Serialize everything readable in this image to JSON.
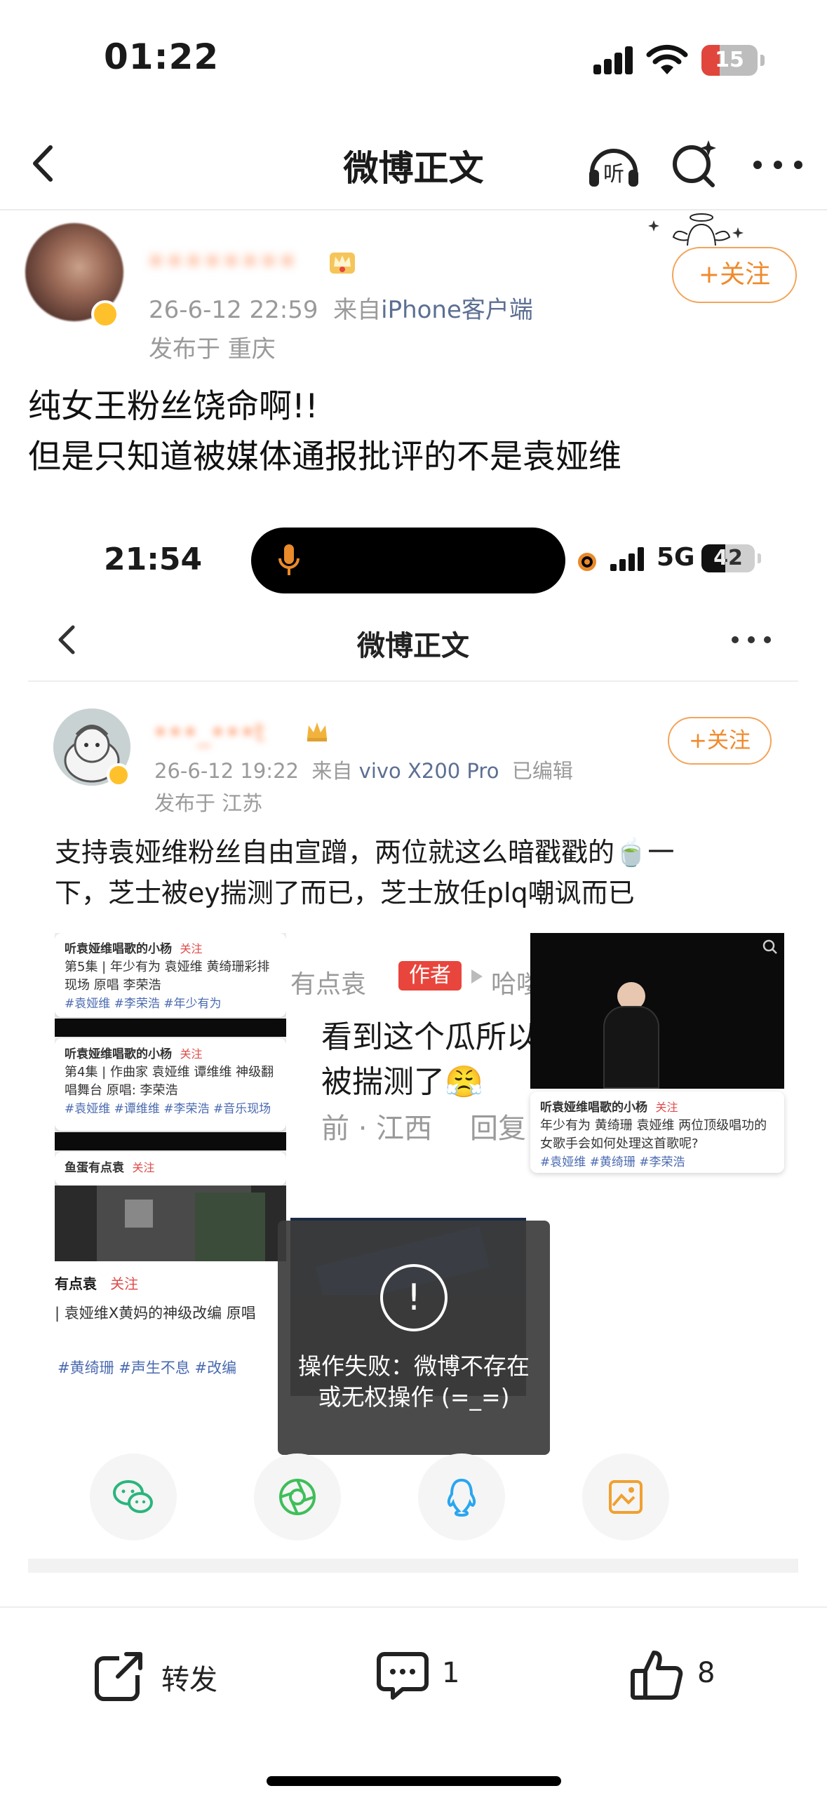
{
  "status_bar": {
    "time": "01:22",
    "battery": "15"
  },
  "nav": {
    "title": "微博正文"
  },
  "post": {
    "username": "••••••••",
    "timestamp": "26-6-12 22:59",
    "source_prefix": "来自",
    "source": "iPhone客户端",
    "location": "发布于 重庆",
    "follow_label": "+关注",
    "text_line1": "纯女王粉丝饶命啊!!",
    "text_line2": "但是只知道被媒体通报批评的不是袁娅维"
  },
  "embedded": {
    "status_time": "21:54",
    "network": "5G",
    "battery": "42",
    "nav_title": "微博正文",
    "username": "•••_•••t",
    "timestamp": "26-6-12 19:22",
    "source_prefix": "来自",
    "source": "vivo X200 Pro",
    "edited": "已编辑",
    "location": "发布于 江苏",
    "follow_label": "+关注",
    "text_line1": "支持袁娅维粉丝自由宣蹭，两位就这么暗戳戳的🍵一",
    "text_line2": "下，芝士被ey揣测了而已，芝士放任plq嘲讽而已",
    "collage": {
      "card1_user": "听袁娅维唱歌的小杨",
      "card1_follow": "关注",
      "card1_title": "第5集 | 年少有为 袁娅维 黄绮珊彩排现场 原唱 李荣浩",
      "card1_tags": "#袁娅维 #李荣浩 #年少有为",
      "card2_user": "听袁娅维唱歌的小杨",
      "card2_follow": "关注",
      "card2_title": "第4集 | 作曲家 袁娅维 谭维维 神级翻唱舞台 原唱: 李荣浩",
      "card2_tags": "#袁娅维 #谭维维 #李荣浩 #音乐现场",
      "card3_user": "鱼蛋有点袁",
      "card3_follow": "关注",
      "card4_user": "有点袁",
      "card4_follow": "关注",
      "card4_title": "| 袁娅维X黄妈的神级改编 原唱",
      "card4_tags": "#黄绮珊 #声生不息 #改编",
      "reply_name": "有点袁",
      "reply_author": "作者",
      "reply_to": "哈喽",
      "reply_text1": "看到这个瓜所以才",
      "reply_text2": "被揣测了😤",
      "reply_meta": "前 · 江西",
      "reply_action": "回复",
      "card5_user": "听袁娅维唱歌的小杨",
      "card5_follow": "关注",
      "card5_title": "年少有为 黄绮珊 袁娅维 两位顶级唱功的女歌手会如何处理这首歌呢?",
      "card5_tags": "#袁娅维 #黄绮珊 #李荣浩"
    },
    "toast": {
      "icon": "!",
      "message": "操作失败：微博不存在或无权操作 (=_=)"
    }
  },
  "bottom_bar": {
    "repost_label": "转发",
    "comment_count": "1",
    "like_count": "8"
  },
  "icons": [
    "back-icon",
    "listen-icon",
    "search-icon",
    "more-icon",
    "wechat-icon",
    "moments-icon",
    "qq-icon",
    "save-image-icon",
    "repost-icon",
    "comment-icon",
    "like-icon"
  ],
  "colors": {
    "accent": "#f08a2c",
    "link": "#5c6f93",
    "tag": "#4a6ab0",
    "author_badge": "#e8453c"
  }
}
